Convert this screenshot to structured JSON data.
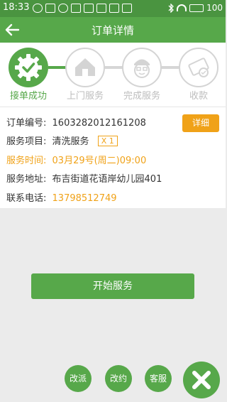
{
  "status_bar": {
    "time": "18:33",
    "battery": "100",
    "icons": [
      "infinity-icon",
      "usb-icon",
      "sync-icon",
      "camera-icon",
      "image-icon",
      "mail-icon",
      "sim-icon",
      "download-icon",
      "bluetooth-icon",
      "wifi-icon",
      "battery-icon"
    ]
  },
  "header": {
    "title": "订单详情"
  },
  "steps": [
    {
      "label": "接单成功",
      "state": "done",
      "icon": "check-gear-icon"
    },
    {
      "label": "上门服务",
      "state": "pending",
      "icon": "house-icon"
    },
    {
      "label": "完成服务",
      "state": "pending",
      "icon": "worker-face-icon"
    },
    {
      "label": "收款",
      "state": "pending",
      "icon": "money-icon"
    }
  ],
  "order": {
    "number_label": "订单编号:",
    "number": "1603282012161208",
    "detail_button": "详细",
    "service_label": "服务项目:",
    "service": "清洗服务",
    "quantity": "X 1",
    "time_label": "服务时间:",
    "time": "03月29号(周二)09:00",
    "address_label": "服务地址:",
    "address": "布吉街道花语岸幼儿园401",
    "phone_label": "联系电话:",
    "phone": "13798512749"
  },
  "actions": {
    "start": "开始服务",
    "reassign": "改派",
    "reschedule": "改约",
    "support": "客服"
  },
  "colors": {
    "primary_green": "#57a84a",
    "status_green": "#4a9440",
    "accent_orange": "#f0a218"
  }
}
